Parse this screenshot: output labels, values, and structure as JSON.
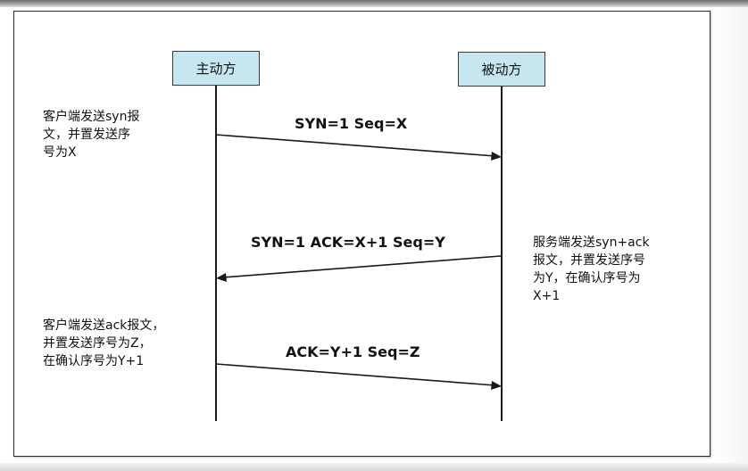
{
  "participants": {
    "left": "主动方",
    "right": "被动方"
  },
  "messages": [
    {
      "label": "SYN=1  Seq=X",
      "direction": "left-to-right"
    },
    {
      "label": "SYN=1  ACK=X+1  Seq=Y",
      "direction": "right-to-left"
    },
    {
      "label": "ACK=Y+1  Seq=Z",
      "direction": "left-to-right"
    }
  ],
  "notes": [
    {
      "lines": [
        "客户端发送syn报",
        "文，并置发送序",
        "号为X"
      ]
    },
    {
      "lines": [
        "服务端发送syn+ack",
        "报文，并置发送序号",
        "为Y，在确认序号为",
        "X+1"
      ]
    },
    {
      "lines": [
        "客户端发送ack报文，",
        "并置发送序号为Z，",
        "在确认序号为Y+1"
      ]
    }
  ],
  "colors": {
    "participant_fill": "#c6e7f0",
    "line": "#1a1a1a",
    "frame_border": "#2a2a2a"
  }
}
